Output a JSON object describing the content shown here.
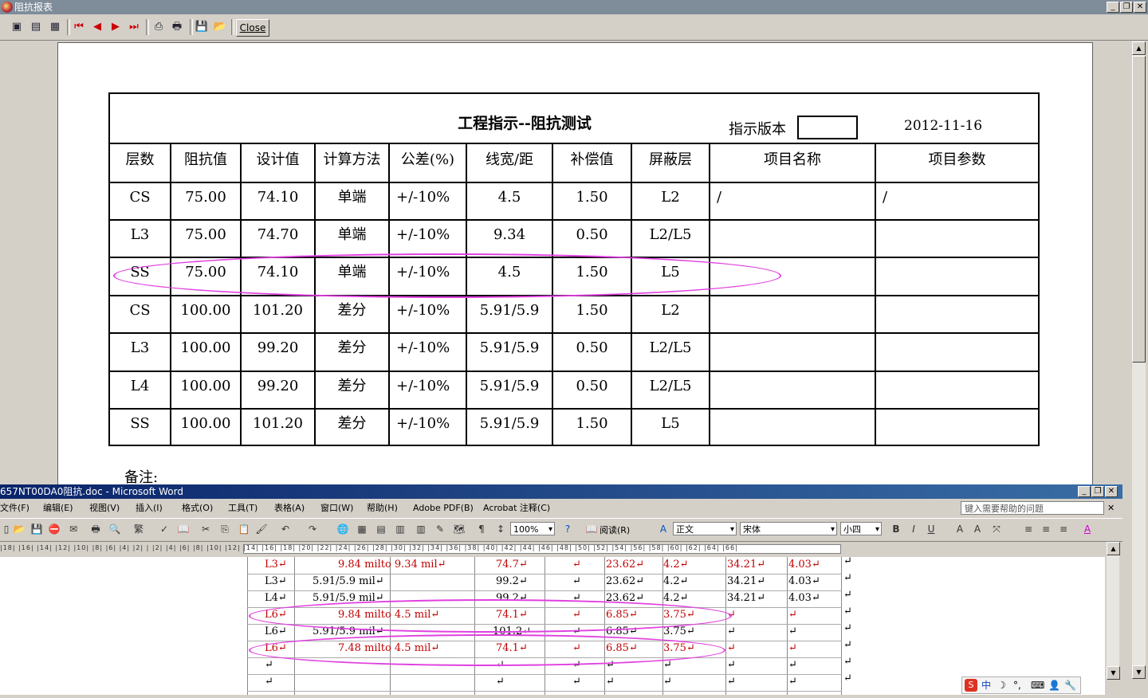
{
  "report_window": {
    "title": "阻抗报表",
    "close_label": "Close",
    "toolbar_icons": [
      "page-single-icon",
      "page-multi-icon",
      "page-fit-icon",
      "first-page-icon",
      "prev-page-icon",
      "next-page-icon",
      "last-page-icon",
      "print-setup-icon",
      "print-icon",
      "save-icon",
      "open-icon"
    ]
  },
  "report": {
    "title": "工程指示--阻抗测试",
    "version_label": "指示版本",
    "version_value": "",
    "date": "2012-11-16",
    "headers": [
      "层数",
      "阻抗值",
      "设计值",
      "计算方法",
      "公差(%)",
      "线宽/距",
      "补偿值",
      "屏蔽层",
      "项目名称",
      "项目参数"
    ],
    "rows": [
      [
        "CS",
        "75.00",
        "74.10",
        "单端",
        "+/-10%",
        "4.5",
        "1.50",
        "L2",
        "/",
        "/"
      ],
      [
        "L3",
        "75.00",
        "74.70",
        "单端",
        "+/-10%",
        "9.34",
        "0.50",
        "L2/L5",
        "",
        ""
      ],
      [
        "SS",
        "75.00",
        "74.10",
        "单端",
        "+/-10%",
        "4.5",
        "1.50",
        "L5",
        "",
        ""
      ],
      [
        "CS",
        "100.00",
        "101.20",
        "差分",
        "+/-10%",
        "5.91/5.9",
        "1.50",
        "L2",
        "",
        ""
      ],
      [
        "L3",
        "100.00",
        "99.20",
        "差分",
        "+/-10%",
        "5.91/5.9",
        "0.50",
        "L2/L5",
        "",
        ""
      ],
      [
        "L4",
        "100.00",
        "99.20",
        "差分",
        "+/-10%",
        "5.91/5.9",
        "0.50",
        "L2/L5",
        "",
        ""
      ],
      [
        "SS",
        "100.00",
        "101.20",
        "差分",
        "+/-10%",
        "5.91/5.9",
        "1.50",
        "L5",
        "",
        ""
      ]
    ],
    "remark_label": "备注:"
  },
  "word_window": {
    "title": "657NT00DA0阻抗.doc - Microsoft Word",
    "menu": [
      "文件(F)",
      "编辑(E)",
      "视图(V)",
      "插入(I)",
      "格式(O)",
      "工具(T)",
      "表格(A)",
      "窗口(W)",
      "帮助(H)",
      "Adobe PDF(B)",
      "Acrobat 注释(C)"
    ],
    "help_placeholder": "键入需要帮助的问题",
    "zoom": "100%",
    "read_label": "阅读(R)",
    "style": "正文",
    "font": "宋体",
    "size": "小四",
    "ruler_text": "|18| |16| |14| |12| |10| |8| |6| |4| |2| | |2| |4| |6| |8| |10| |12| |14| |16| |18| |20| |22| |24| |26| |28| |30| |32| |34| |36| |38| |40| |42| |44| |46| |48| |50| |52| |54| |56| |58| |60| |62| |64| |66|",
    "rows": [
      [
        "L3↵",
        "9.84 milto 9.34 mil↵",
        "74.7↵",
        "↵",
        "23.62↵",
        "4.2↵",
        "34.21↵",
        "4.03↵"
      ],
      [
        "L3↵",
        "5.91/5.9 mil↵",
        "99.2↵",
        "↵",
        "23.62↵",
        "4.2↵",
        "34.21↵",
        "4.03↵"
      ],
      [
        "L4↵",
        "5.91/5.9 mil↵",
        "99.2↵",
        "↵",
        "23.62↵",
        "4.2↵",
        "34.21↵",
        "4.03↵"
      ],
      [
        "L6↵",
        "9.84 milto 4.5 mil↵",
        "74.1↵",
        "↵",
        "6.85↵",
        "3.75↵",
        "↵",
        "↵"
      ],
      [
        "L6↵",
        "5.91/5.9 mil↵",
        "101.2↵",
        "↵",
        "6.85↵",
        "3.75↵",
        "↵",
        "↵"
      ],
      [
        "L6↵",
        "7.48 milto 4.5 mil↵",
        "74.1↵",
        "↵",
        "6.85↵",
        "3.75↵",
        "↵",
        "↵"
      ],
      [
        "↵",
        "",
        "↵",
        "↵",
        "↵",
        "↵",
        "↵",
        "↵"
      ],
      [
        "↵",
        "",
        "↵",
        "↵",
        "↵",
        "↵",
        "↵",
        "↵"
      ]
    ],
    "red_rows": [
      0,
      3,
      5
    ],
    "end_marks": [
      "↵",
      "↵",
      "↵",
      "↵",
      "↵",
      "↵",
      "↵",
      "↵"
    ]
  },
  "ime_bar": {
    "label": "中"
  },
  "colors": {
    "highlight": "#e040e0",
    "red_text": "#c00000"
  }
}
